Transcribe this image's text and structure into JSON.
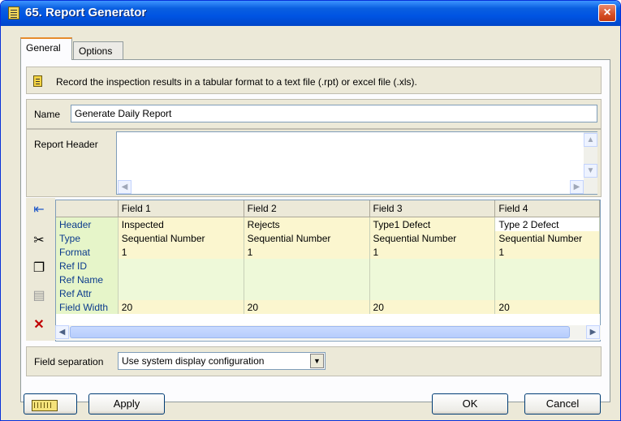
{
  "window": {
    "title": "65. Report Generator",
    "close_icon": "×"
  },
  "tabs": [
    {
      "label": "General"
    },
    {
      "label": "Options"
    }
  ],
  "description": "Record the inspection results in a tabular format to a text file (.rpt) or excel file (.xls).",
  "name": {
    "label": "Name",
    "value": "Generate Daily Report"
  },
  "report_header": {
    "label": "Report Header",
    "value": ""
  },
  "toolbar": {
    "icons": [
      "insert-field-icon",
      "cut-icon",
      "copy-icon",
      "paste-icon",
      "delete-icon"
    ]
  },
  "grid": {
    "columns": [
      "Field 1",
      "Field 2",
      "Field 3",
      "Field 4"
    ],
    "rows": [
      {
        "label": "Header",
        "values": [
          "Inspected",
          "Rejects",
          "Type1 Defect",
          "Type 2 Defect"
        ]
      },
      {
        "label": "Type",
        "values": [
          "Sequential Number",
          "Sequential Number",
          "Sequential Number",
          "Sequential Number"
        ]
      },
      {
        "label": "Format",
        "values": [
          "1",
          "1",
          "1",
          "1"
        ]
      },
      {
        "label": "Ref ID",
        "values": [
          "",
          "",
          "",
          ""
        ]
      },
      {
        "label": "Ref Name",
        "values": [
          "",
          "",
          "",
          ""
        ]
      },
      {
        "label": "Ref Attr",
        "values": [
          "",
          "",
          "",
          ""
        ]
      },
      {
        "label": "Field Width",
        "values": [
          "20",
          "20",
          "20",
          "20"
        ]
      }
    ]
  },
  "field_separation": {
    "label": "Field separation",
    "value": "Use system display configuration"
  },
  "buttons": {
    "apply": "Apply",
    "ok": "OK",
    "cancel": "Cancel"
  }
}
